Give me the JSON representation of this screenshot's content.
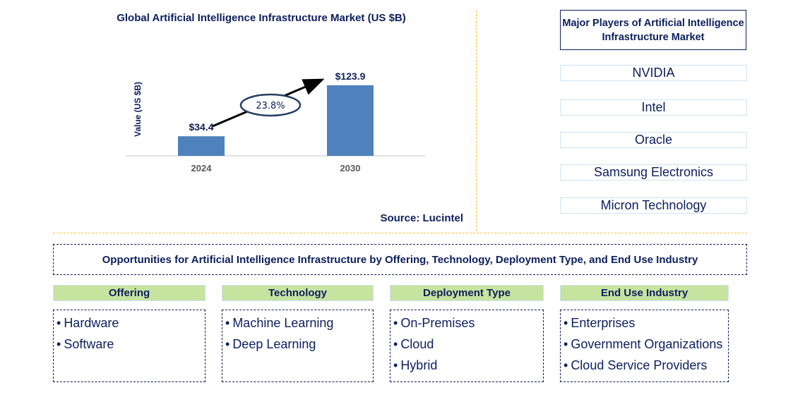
{
  "chart_data": {
    "type": "bar",
    "title": "Global Artificial Intelligence Infrastructure Market (US $B)",
    "xlabel": "",
    "ylabel": "Value (US $B)",
    "categories": [
      "2024",
      "2030"
    ],
    "values": [
      34.4,
      123.9
    ],
    "data_labels": [
      "$34.4",
      "$123.9"
    ],
    "ylim": [
      0,
      130
    ],
    "grid": false,
    "bar_color": "#4f81bd",
    "annotation": {
      "text": "23.8%",
      "meaning": "CAGR growth from 2024 to 2030"
    }
  },
  "source": "Source: Lucintel",
  "players": {
    "heading": "Major Players of Artificial Intelligence Infrastructure Market",
    "items": [
      "NVIDIA",
      "Intel",
      "Oracle",
      "Samsung Electronics",
      "Micron Technology"
    ]
  },
  "opportunities": {
    "heading": "Opportunities for Artificial Intelligence Infrastructure by Offering, Technology, Deployment Type, and End Use Industry",
    "categories": [
      {
        "label": "Offering",
        "items": [
          "Hardware",
          "Software"
        ]
      },
      {
        "label": "Technology",
        "items": [
          "Machine Learning",
          "Deep Learning"
        ]
      },
      {
        "label": "Deployment Type",
        "items": [
          "On-Premises",
          "Cloud",
          "Hybrid"
        ]
      },
      {
        "label": "End Use Industry",
        "items": [
          "Enterprises",
          "Government Organizations",
          "Cloud Service Providers"
        ]
      }
    ]
  },
  "colors": {
    "text_primary": "#0d1f5c",
    "bar": "#4f81bd",
    "category_header_bg": "#c6e3a0",
    "divider": "#f5c030"
  },
  "bullet_glyph": "•"
}
